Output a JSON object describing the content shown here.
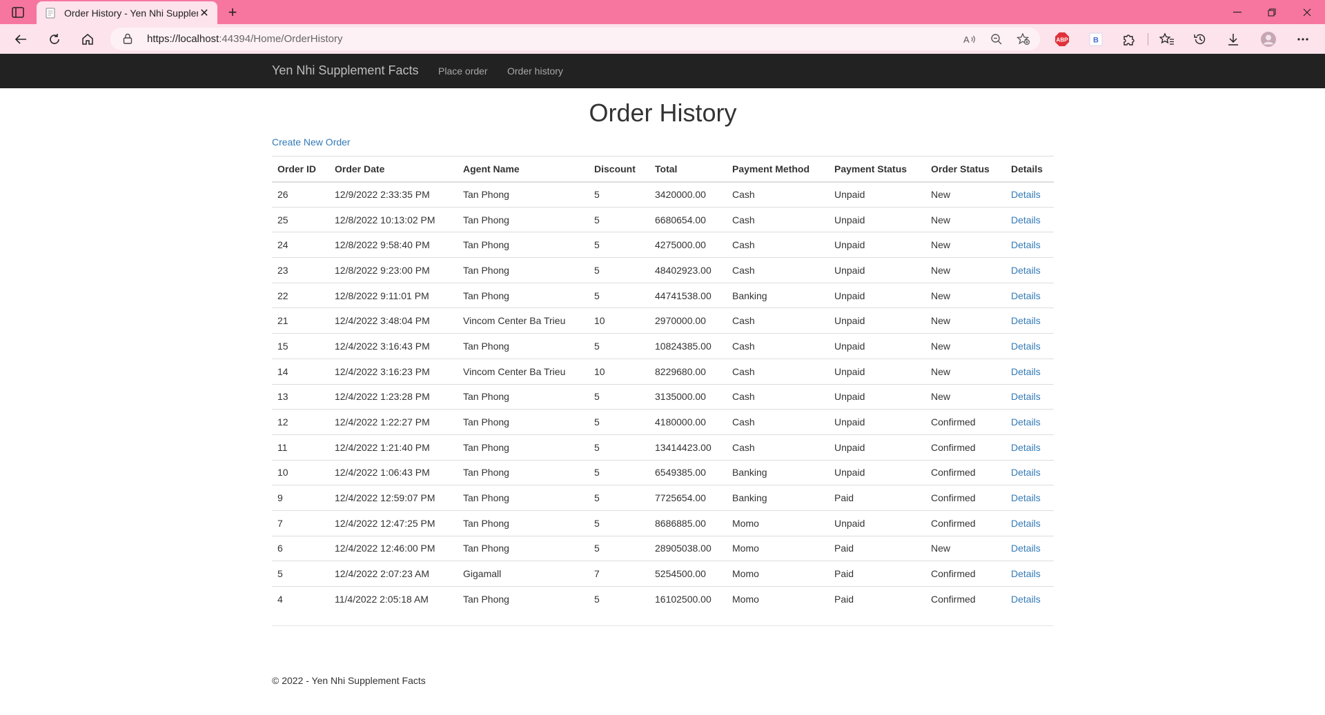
{
  "browser": {
    "tab_title": "Order History - Yen Nhi Supplem",
    "url_host": "https://localhost",
    "url_rest": ":44394/Home/OrderHistory",
    "colors": {
      "tabstrip": "#f6769f",
      "toolbar": "#fde3ec"
    }
  },
  "navbar": {
    "brand": "Yen Nhi Supplement Facts",
    "links": [
      "Place order",
      "Order history"
    ]
  },
  "page": {
    "title": "Order History",
    "create_link": "Create New Order"
  },
  "table": {
    "headers": [
      "Order ID",
      "Order Date",
      "Agent Name",
      "Discount",
      "Total",
      "Payment Method",
      "Payment Status",
      "Order Status",
      "Details"
    ],
    "rows": [
      [
        "26",
        "12/9/2022 2:33:35 PM",
        "Tan Phong",
        "5",
        "3420000.00",
        "Cash",
        "Unpaid",
        "New",
        "Details"
      ],
      [
        "25",
        "12/8/2022 10:13:02 PM",
        "Tan Phong",
        "5",
        "6680654.00",
        "Cash",
        "Unpaid",
        "New",
        "Details"
      ],
      [
        "24",
        "12/8/2022 9:58:40 PM",
        "Tan Phong",
        "5",
        "4275000.00",
        "Cash",
        "Unpaid",
        "New",
        "Details"
      ],
      [
        "23",
        "12/8/2022 9:23:00 PM",
        "Tan Phong",
        "5",
        "48402923.00",
        "Cash",
        "Unpaid",
        "New",
        "Details"
      ],
      [
        "22",
        "12/8/2022 9:11:01 PM",
        "Tan Phong",
        "5",
        "44741538.00",
        "Banking",
        "Unpaid",
        "New",
        "Details"
      ],
      [
        "21",
        "12/4/2022 3:48:04 PM",
        "Vincom Center Ba Trieu",
        "10",
        "2970000.00",
        "Cash",
        "Unpaid",
        "New",
        "Details"
      ],
      [
        "15",
        "12/4/2022 3:16:43 PM",
        "Tan Phong",
        "5",
        "10824385.00",
        "Cash",
        "Unpaid",
        "New",
        "Details"
      ],
      [
        "14",
        "12/4/2022 3:16:23 PM",
        "Vincom Center Ba Trieu",
        "10",
        "8229680.00",
        "Cash",
        "Unpaid",
        "New",
        "Details"
      ],
      [
        "13",
        "12/4/2022 1:23:28 PM",
        "Tan Phong",
        "5",
        "3135000.00",
        "Cash",
        "Unpaid",
        "New",
        "Details"
      ],
      [
        "12",
        "12/4/2022 1:22:27 PM",
        "Tan Phong",
        "5",
        "4180000.00",
        "Cash",
        "Unpaid",
        "Confirmed",
        "Details"
      ],
      [
        "11",
        "12/4/2022 1:21:40 PM",
        "Tan Phong",
        "5",
        "13414423.00",
        "Cash",
        "Unpaid",
        "Confirmed",
        "Details"
      ],
      [
        "10",
        "12/4/2022 1:06:43 PM",
        "Tan Phong",
        "5",
        "6549385.00",
        "Banking",
        "Unpaid",
        "Confirmed",
        "Details"
      ],
      [
        "9",
        "12/4/2022 12:59:07 PM",
        "Tan Phong",
        "5",
        "7725654.00",
        "Banking",
        "Paid",
        "Confirmed",
        "Details"
      ],
      [
        "7",
        "12/4/2022 12:47:25 PM",
        "Tan Phong",
        "5",
        "8686885.00",
        "Momo",
        "Unpaid",
        "Confirmed",
        "Details"
      ],
      [
        "6",
        "12/4/2022 12:46:00 PM",
        "Tan Phong",
        "5",
        "28905038.00",
        "Momo",
        "Paid",
        "New",
        "Details"
      ],
      [
        "5",
        "12/4/2022 2:07:23 AM",
        "Gigamall",
        "7",
        "5254500.00",
        "Momo",
        "Paid",
        "Confirmed",
        "Details"
      ],
      [
        "4",
        "11/4/2022 2:05:18 AM",
        "Tan Phong",
        "5",
        "16102500.00",
        "Momo",
        "Paid",
        "Confirmed",
        "Details"
      ]
    ]
  },
  "footer": {
    "text": "© 2022 - Yen Nhi Supplement Facts"
  }
}
